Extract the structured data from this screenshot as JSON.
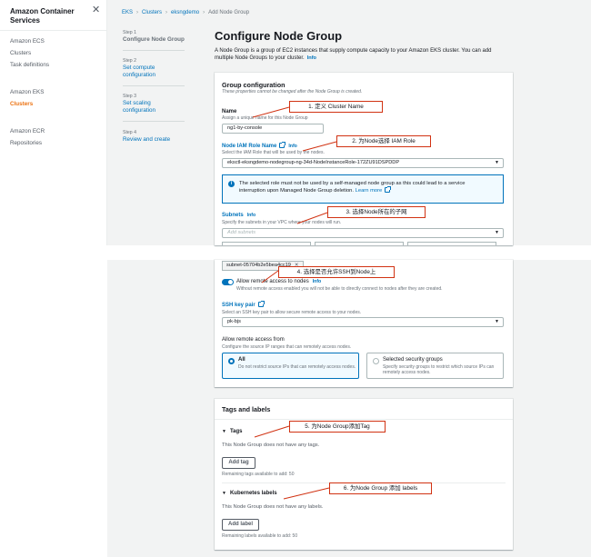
{
  "sidenav": {
    "title": "Amazon Container Services",
    "items": [
      {
        "label": "Amazon ECS",
        "active": false
      },
      {
        "label": "Clusters",
        "active": false
      },
      {
        "label": "Task definitions",
        "active": false
      },
      {
        "label": "Amazon EKS",
        "active": false
      },
      {
        "label": "Clusters",
        "active": true
      },
      {
        "label": "Amazon ECR",
        "active": false
      },
      {
        "label": "Repositories",
        "active": false
      }
    ]
  },
  "breadcrumb": [
    "EKS",
    "Clusters",
    "eksngdemo",
    "Add Node Group"
  ],
  "steps": [
    {
      "num": "Step 1",
      "label": "Configure Node Group"
    },
    {
      "num": "Step 2",
      "label": "Set compute configuration"
    },
    {
      "num": "Step 3",
      "label": "Set scaling configuration"
    },
    {
      "num": "Step 4",
      "label": "Review and create"
    }
  ],
  "page": {
    "title": "Configure Node Group",
    "description": "A Node Group is a group of EC2 instances that supply compute capacity to your Amazon EKS cluster. You can add multiple Node Groups to your cluster.",
    "info": "Info"
  },
  "group_config": {
    "title": "Group configuration",
    "subtitle": "These properties cannot be changed after the Node Group is created.",
    "name_label": "Name",
    "name_desc": "Assign a unique name for this Node Group",
    "name_value": "ng1-by-console",
    "iam_label": "Node IAM Role Name",
    "iam_info": "Info",
    "iam_desc": "Select the IAM Role that will be used by the nodes.",
    "iam_value": "eksctl-eksngdemo-nodegroup-ng-34d-NodeInstanceRole-172ZU91DSPDDP",
    "alert_text": "The selected role must not be used by a self-managed node group as this could lead to a service interruption upon Managed Node Group deletion.",
    "alert_link": "Learn more",
    "subnets_label": "Subnets",
    "subnets_info": "Info",
    "subnets_desc": "Specify the subnets in your VPC where your nodes will run.",
    "subnets_placeholder": "Add subnets",
    "subnet_token": "subnet-05704b2e5bea4cc19",
    "remote_toggle_label": "Allow remote access to nodes",
    "remote_toggle_info": "Info",
    "remote_toggle_desc": "Without remote access enabled you will not be able to directly connect to nodes after they are created.",
    "ssh_label": "SSH key pair",
    "ssh_desc": "Select an SSH key pair to allow secure remote access to your nodes.",
    "ssh_value": "pk-bjs",
    "access_from_label": "Allow remote access from",
    "access_from_desc": "Configure the source IP ranges that can remotely access nodes.",
    "option_all_title": "All",
    "option_all_desc": "Do not restrict source IPs that can remotely access nodes.",
    "option_sg_title": "Selected security groups",
    "option_sg_desc": "Specify security groups to restrict which source IPs can remotely access nodes."
  },
  "tags_labels": {
    "title": "Tags and labels",
    "tags_header": "Tags",
    "tags_empty": "This Node Group does not have any tags.",
    "add_tag": "Add tag",
    "tags_remaining": "Remaining tags available to add: 50",
    "k8s_header": "Kubernetes labels",
    "k8s_empty": "This Node Group does not have any labels.",
    "add_label": "Add label",
    "labels_remaining": "Remaining labels available to add: 50"
  },
  "annotations": [
    "1. 定义 Cluster Name",
    "2. 为Node选择 IAM Role",
    "3. 选择Node所在的子网",
    "4. 选择是否允许SSH到Node上",
    "5. 为Node Group添加Tag",
    "6. 为Node Group 添加 labels"
  ],
  "colors": {
    "link": "#0073bb",
    "active_nav": "#ec7211",
    "callout_border": "#d13212",
    "page_bg": "#f2f3f3"
  }
}
